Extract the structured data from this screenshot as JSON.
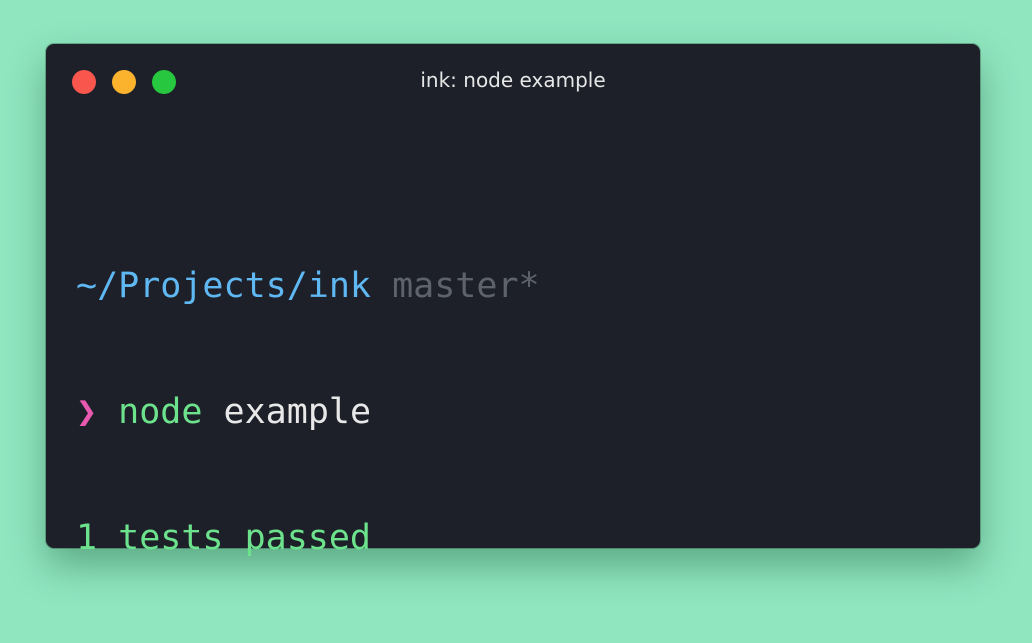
{
  "colors": {
    "background": "#8fe6bf",
    "window": "#1d2029",
    "close": "#f9564d",
    "minimize": "#fbb22c",
    "maximize": "#27c73f",
    "path": "#5fb8f2",
    "branch": "#5e626b",
    "prompt": "#e75ab0",
    "command": "#6de28c",
    "argument": "#e8e8e8",
    "output": "#6de28c"
  },
  "window": {
    "title": "ink: node example"
  },
  "terminal": {
    "path": "~/Projects/ink",
    "branch": "master*",
    "prompt_symbol": "❯",
    "command": "node",
    "argument": "example",
    "output": "1 tests passed"
  }
}
